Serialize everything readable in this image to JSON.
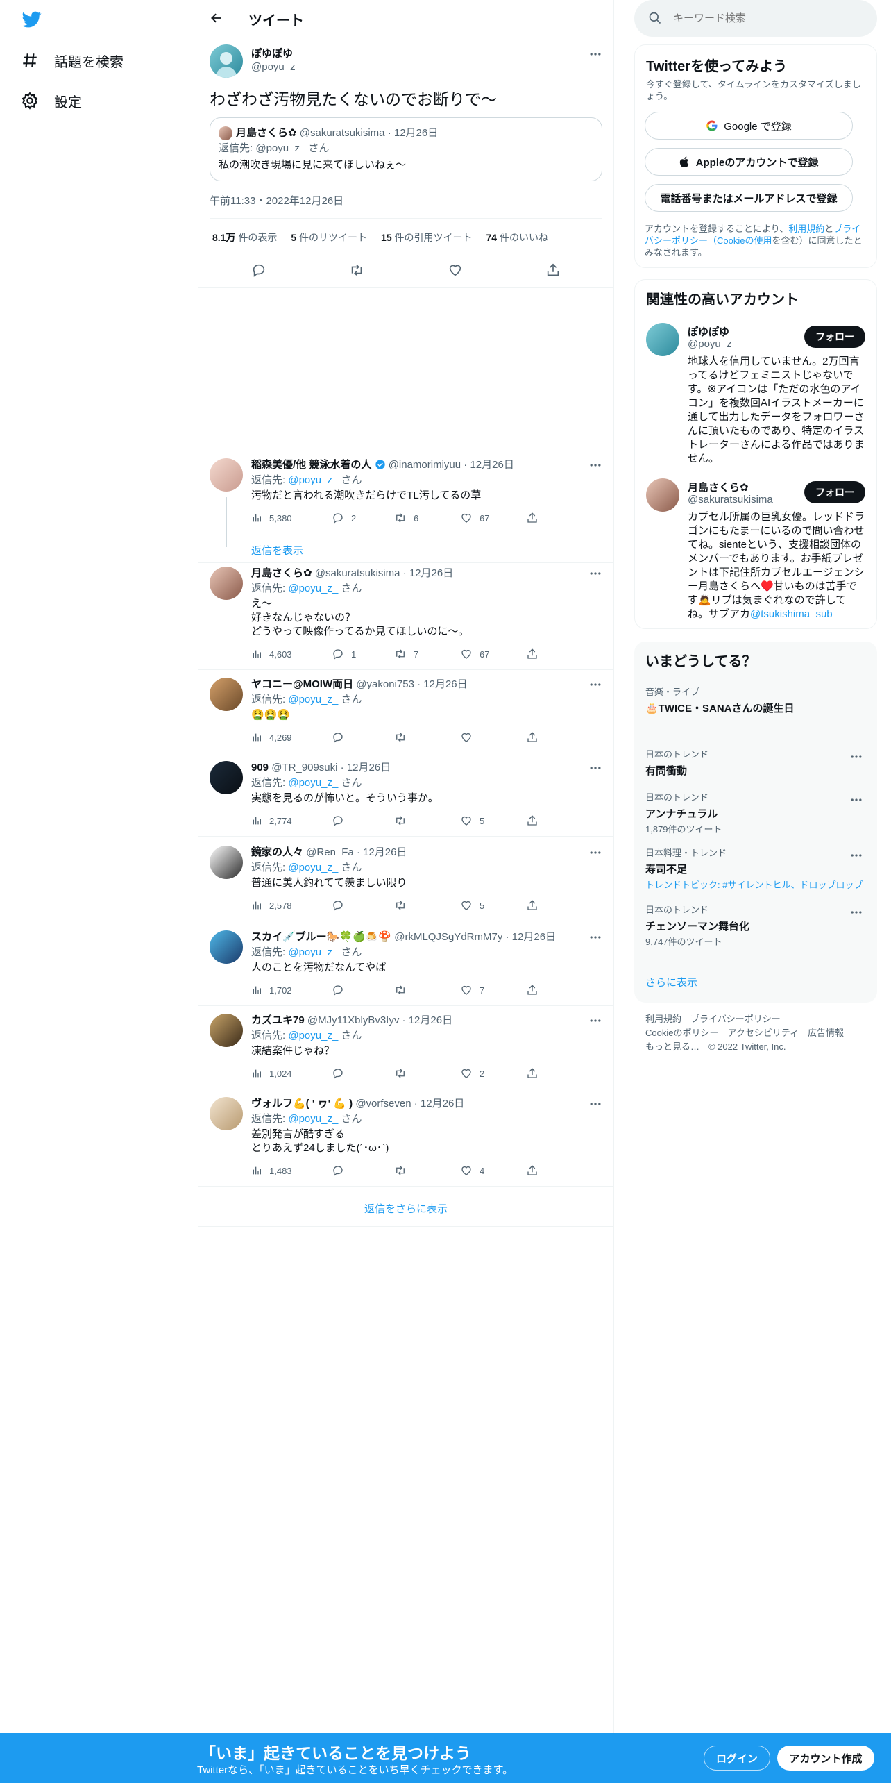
{
  "nav": {
    "items": [
      {
        "label": "話題を検索"
      },
      {
        "label": "設定"
      }
    ]
  },
  "header": {
    "title": "ツイート"
  },
  "main_tweet": {
    "name": "ぽゆぽゆ",
    "handle": "@poyu_z_",
    "text": "わざわざ汚物見たくないのでお断りで〜",
    "quote": {
      "name": "月島さくら✿",
      "handle": "@sakuratsukisima",
      "date": "12月26日",
      "reply_to_prefix": "返信先: ",
      "reply_to": "@poyu_z_",
      "reply_to_suffix": "さん",
      "text": "私の潮吹き現場に見に来てほしいねぇ〜"
    },
    "timestamp": "午前11:33・2022年12月26日",
    "stats": {
      "views_num": "8.1万",
      "views_label": "件の表示",
      "retweets_num": "5",
      "retweets_label": "件のリツイート",
      "quotes_num": "15",
      "quotes_label": "件の引用ツイート",
      "likes_num": "74",
      "likes_label": "件のいいね"
    }
  },
  "replies": [
    {
      "name": "稲森美優/他 競泳水着の人",
      "verified": true,
      "handle": "@inamorimiyuu",
      "date": "12月26日",
      "reply_prefix": "返信先: ",
      "reply_to": "@poyu_z_",
      "reply_suffix": "さん",
      "lines": [
        "汚物だと言われる潮吹きだらけでTL汚してるの草"
      ],
      "views": "5,380",
      "replies": "2",
      "retweets": "6",
      "likes": "67",
      "show_thread": "返信を表示"
    },
    {
      "name": "月島さくら✿",
      "verified": false,
      "handle": "@sakuratsukisima",
      "date": "12月26日",
      "reply_prefix": "返信先: ",
      "reply_to": "@poyu_z_",
      "reply_suffix": "さん",
      "lines": [
        "え〜",
        "好きなんじゃないの？",
        "どうやって映像作ってるか見てほしいのに〜。"
      ],
      "views": "4,603",
      "replies": "1",
      "retweets": "7",
      "likes": "67"
    },
    {
      "name": "ヤコニー@MOIW両日",
      "verified": false,
      "handle": "@yakoni753",
      "date": "12月26日",
      "reply_prefix": "返信先: ",
      "reply_to": "@poyu_z_",
      "reply_suffix": "さん",
      "lines": [
        "🤮🤮🤮"
      ],
      "views": "4,269",
      "replies": "",
      "retweets": "",
      "likes": ""
    },
    {
      "name": "909",
      "verified": false,
      "handle": "@TR_909suki",
      "date": "12月26日",
      "reply_prefix": "返信先: ",
      "reply_to": "@poyu_z_",
      "reply_suffix": "さん",
      "lines": [
        "実態を見るのが怖いと。そういう事か。"
      ],
      "views": "2,774",
      "replies": "",
      "retweets": "",
      "likes": "5"
    },
    {
      "name": "鏡家の人々",
      "verified": false,
      "handle": "@Ren_Fa",
      "date": "12月26日",
      "reply_prefix": "返信先: ",
      "reply_to": "@poyu_z_",
      "reply_suffix": "さん",
      "lines": [
        "普通に美人釣れてて羨ましい限り"
      ],
      "views": "2,578",
      "replies": "",
      "retweets": "",
      "likes": "5"
    },
    {
      "name": "スカイ💉ブルー🐎🍀🍏🍮🍄",
      "verified": false,
      "handle": "@rkMLQJSgYdRmM7y",
      "date": "12月26日",
      "reply_prefix": "返信先: ",
      "reply_to": "@poyu_z_",
      "reply_suffix": "さん",
      "lines": [
        "人のことを汚物だなんてやば"
      ],
      "views": "1,702",
      "replies": "",
      "retweets": "",
      "likes": "7"
    },
    {
      "name": "カズユキ79",
      "verified": false,
      "handle": "@MJy11XblyBv3Iyv",
      "date": "12月26日",
      "reply_prefix": "返信先: ",
      "reply_to": "@poyu_z_",
      "reply_suffix": "さん",
      "lines": [
        "凍結案件じゃね？"
      ],
      "views": "1,024",
      "replies": "",
      "retweets": "",
      "likes": "2"
    },
    {
      "name": "ヴォルフ💪( ' ヮ' 💪 )",
      "verified": false,
      "handle": "@vorfseven",
      "date": "12月26日",
      "reply_prefix": "返信先: ",
      "reply_to": "@poyu_z_",
      "reply_suffix": "さん",
      "lines": [
        "差別発言が酷すぎる",
        "とりあえず24しました(´･ω･`)"
      ],
      "views": "1,483",
      "replies": "",
      "retweets": "",
      "likes": "4"
    }
  ],
  "more_replies": "返信をさらに表示",
  "search": {
    "placeholder": "キーワード検索"
  },
  "signup": {
    "title": "Twitterを使ってみよう",
    "subtitle": "今すぐ登録して、タイムラインをカスタマイズしましょう。",
    "google": "Google で登録",
    "apple": "Appleのアカウントで登録",
    "phone": "電話番号またはメールアドレスで登録",
    "terms_1": "アカウントを登録することにより、",
    "terms_link1": "利用規約",
    "terms_2": "と",
    "terms_link2": "プライバシーポリシー（Cookieの使用",
    "terms_3": "を含む）に同意したとみなされます。"
  },
  "related": {
    "title": "関連性の高いアカウント",
    "follow_label": "フォロー",
    "accounts": [
      {
        "name": "ぽゆぽゆ",
        "handle": "@poyu_z_",
        "bio": [
          "地球人を信用していません。2万回言",
          "ってるけどフェミニストじゃないで",
          "す。※アイコンは「ただの水色のアイ",
          "コン」を複数回AIイラストメーカーに",
          "通して出力したデータをフォロワーさ",
          "んに頂いたものであり、特定のイラス",
          "トレーターさんによる作品ではありま",
          "せん。"
        ]
      },
      {
        "name": "月島さくら✿",
        "handle": "@sakuratsukisima",
        "bio": [
          "カプセル所属の巨乳女優。レッドドラ",
          "ゴンにもたまーにいるので問い合わせ",
          "てね。sienteという、支援相談団体の",
          "メンバーでもあります。お手紙プレゼ",
          "ントは下記住所カプセルエージェンシ",
          "ー月島さくらへ♥️甘いものは苦手で",
          "す🙇リプは気まぐれなので許して",
          "ね。サブアカ"
        ],
        "bio_link": "@tsukishima_sub_"
      }
    ]
  },
  "trends": {
    "title": "いまどうしてる？",
    "items": [
      {
        "context": "音楽・ライブ",
        "name": "🎂TWICE・SANAさんの誕生日",
        "sub": ""
      },
      {
        "context": "日本のトレンド",
        "name": "有問衝動",
        "sub": ""
      },
      {
        "context": "日本のトレンド",
        "name": "アンナチュラル",
        "sub": "1,879件のツイート"
      },
      {
        "context": "日本料理・トレンド",
        "name": "寿司不足",
        "sub": "トレンドトピック: #サイレントヒル、ドロップロップ",
        "sub_is_link": true
      },
      {
        "context": "日本のトレンド",
        "name": "チェンソーマン舞台化",
        "sub": "9,747件のツイート"
      }
    ],
    "show_more": "さらに表示"
  },
  "footer": {
    "line1": "利用規約　プライバシーポリシー",
    "line2": "Cookieのポリシー　アクセシビリティ　広告情報",
    "line3": "もっと見る…　© 2022 Twitter, Inc."
  },
  "bottombar": {
    "title": "「いま」起きていることを見つけよう",
    "subtitle": "Twitterなら、「いま」起きていることをいち早くチェックできます。",
    "login": "ログイン",
    "signup": "アカウント作成"
  },
  "colors": {
    "accent": "#1d9bf0",
    "text": "#0f1419",
    "muted": "#536471"
  }
}
